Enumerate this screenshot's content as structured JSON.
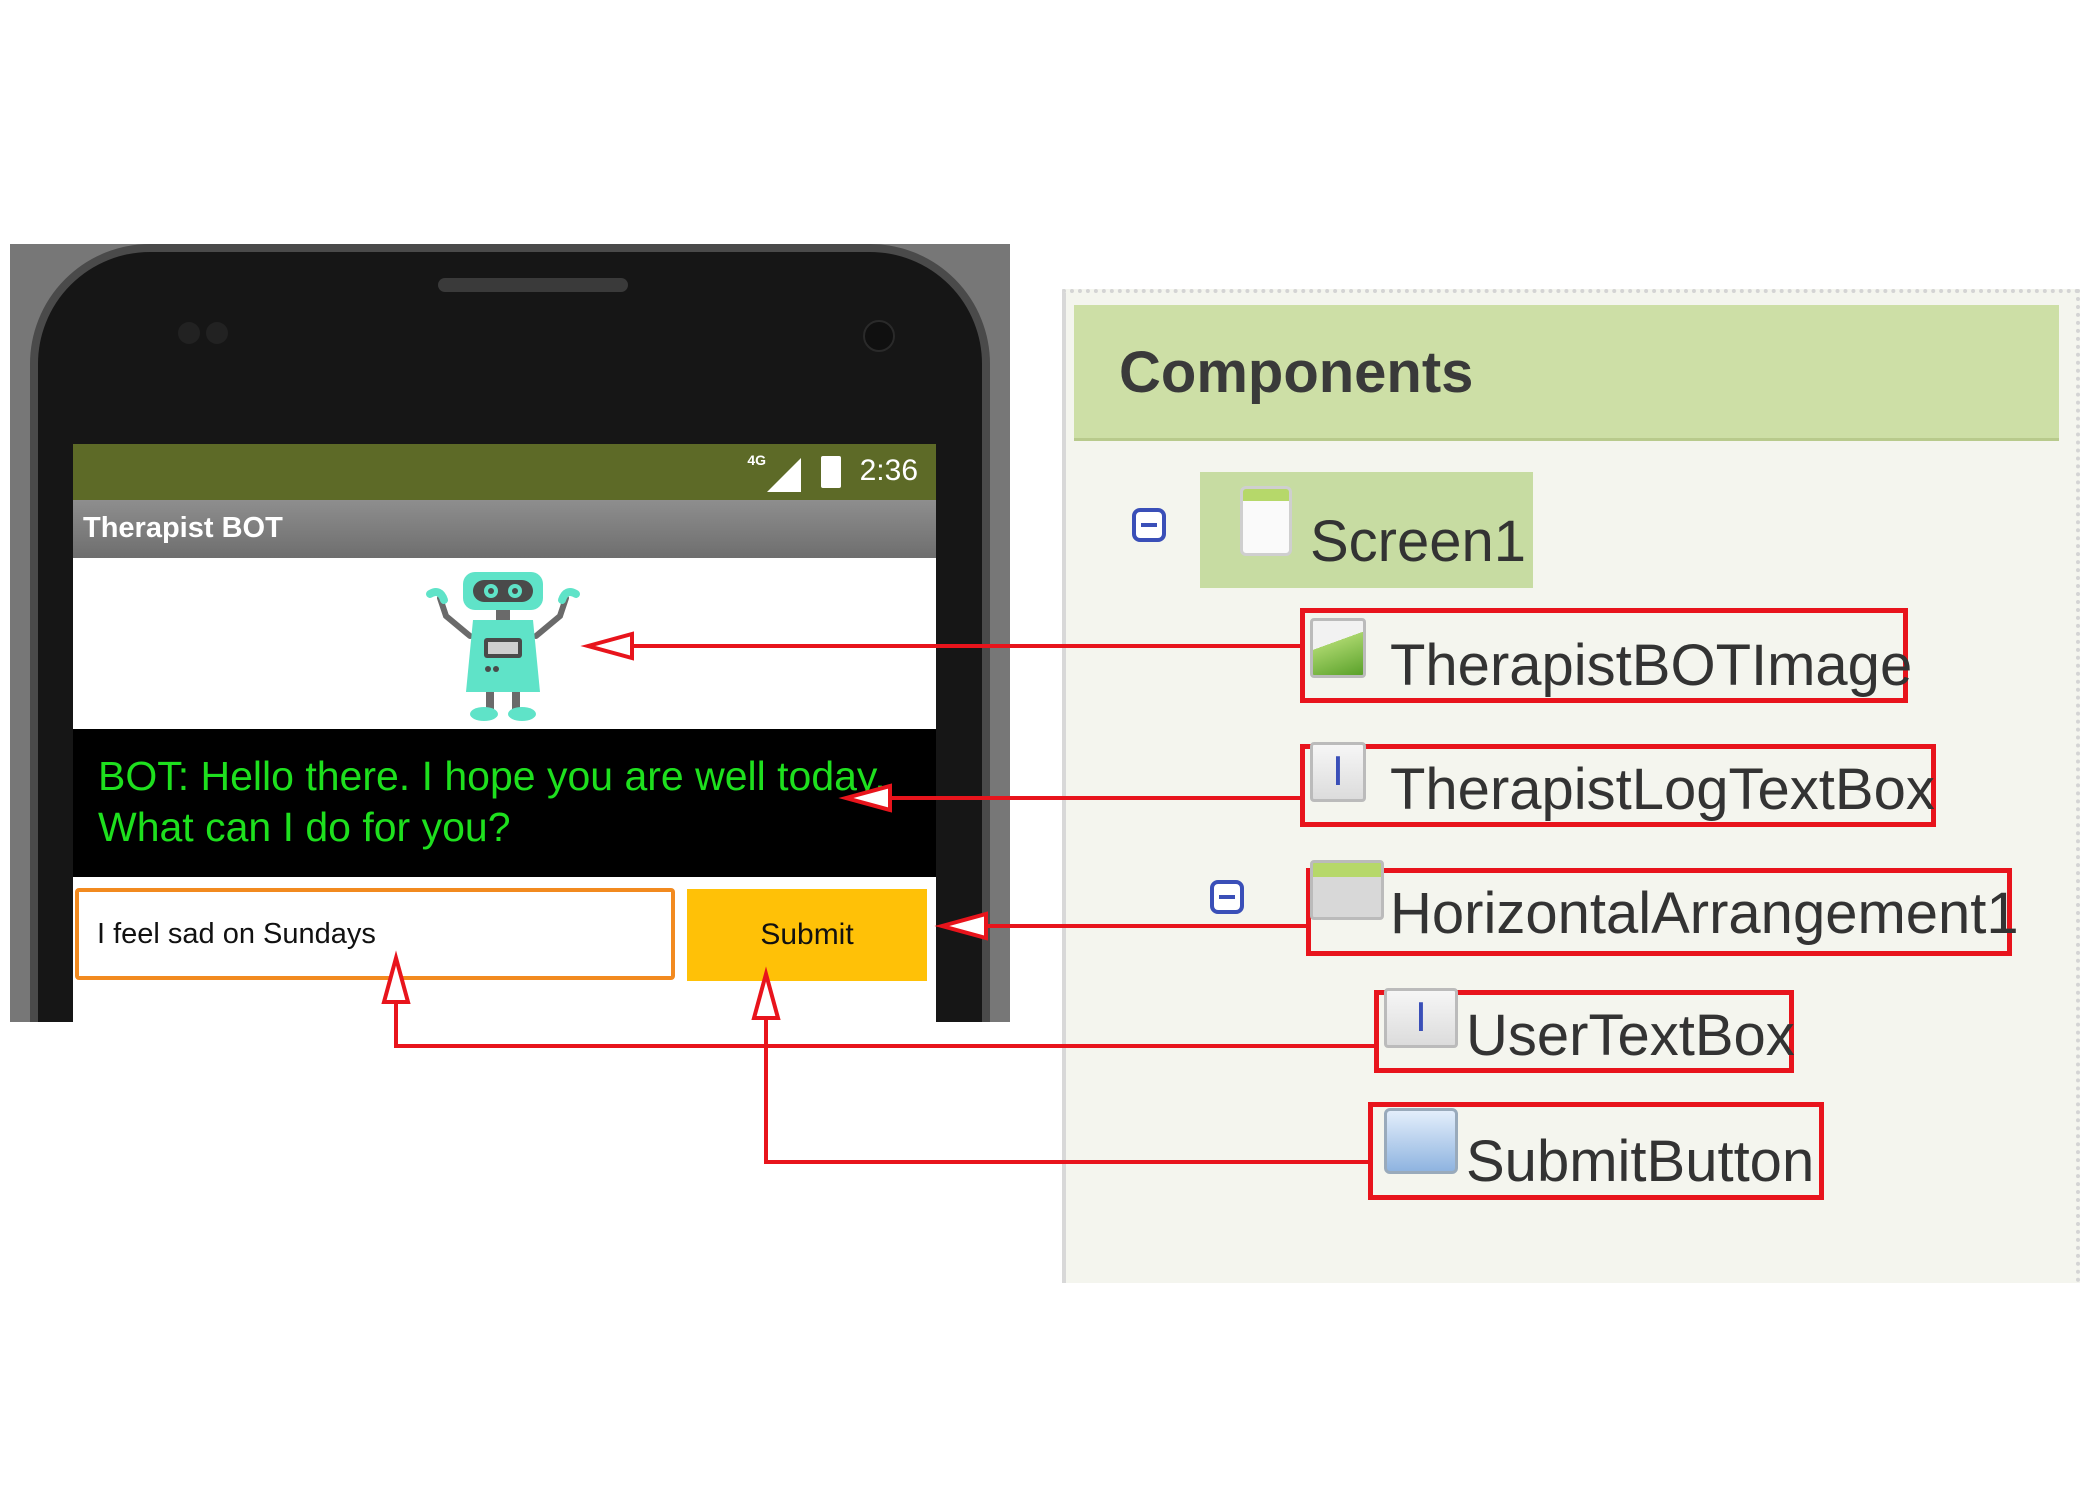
{
  "phone": {
    "status": {
      "network": "4G",
      "time": "2:36"
    },
    "app_title": "Therapist BOT",
    "bot_message": "BOT: Hello there. I hope you are well today.  What can I do for you?",
    "user_input_value": "I feel sad on Sundays",
    "submit_label": "Submit"
  },
  "components": {
    "title": "Components",
    "tree": [
      {
        "label": "Screen1",
        "icon": "screen-icon"
      },
      {
        "label": "TherapistBOTImage",
        "icon": "image-icon"
      },
      {
        "label": "TherapistLogTextBox",
        "icon": "textbox-icon"
      },
      {
        "label": "HorizontalArrangement1",
        "icon": "horizontal-arrangement-icon"
      },
      {
        "label": "UserTextBox",
        "icon": "textbox-icon"
      },
      {
        "label": "SubmitButton",
        "icon": "button-icon"
      }
    ]
  },
  "colors": {
    "status_bar": "#5d6a27",
    "bot_text": "#1ee01e",
    "submit_button": "#ffc107",
    "input_border": "#f28a1f",
    "panel_header": "#cddfa6",
    "annotation": "#e8141c"
  }
}
